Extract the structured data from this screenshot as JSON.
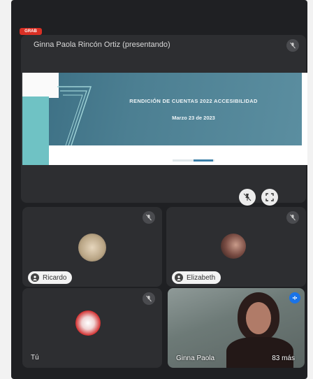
{
  "recording_badge": "GRAB",
  "presenter": {
    "name": "Ginna Paola Rincón Ortiz (presentando)",
    "slide_title": "RENDICIÓN DE CUENTAS 2022 ACCESIBILIDAD",
    "slide_subtitle": "Marzo 23 de 2023"
  },
  "participants": [
    {
      "name": "Ricardo"
    },
    {
      "name": "Elizabeth"
    },
    {
      "name": "Tú"
    }
  ],
  "video_tile": {
    "name": "Ginna Paola",
    "more_label": "83 más"
  },
  "colors": {
    "background": "#1f2023",
    "tile": "#2d2e31",
    "accent_blue": "#1a73e8",
    "record_red": "#d93025"
  }
}
